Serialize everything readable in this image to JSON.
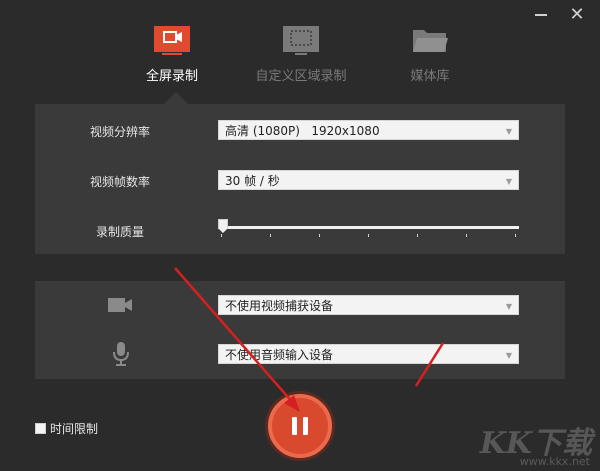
{
  "window": {
    "minimize_label": "—",
    "close_label": "✕"
  },
  "tabs": [
    {
      "id": "fullscreen",
      "label": "全屏录制",
      "active": true,
      "icon": "screen-record-icon"
    },
    {
      "id": "region",
      "label": "自定义区域录制",
      "active": false,
      "icon": "region-select-icon"
    },
    {
      "id": "library",
      "label": "媒体库",
      "active": false,
      "icon": "folder-icon"
    }
  ],
  "video_settings": {
    "resolution": {
      "label": "视频分辨率",
      "value": "高清 (1080P)   1920x1080"
    },
    "framerate": {
      "label": "视频帧数率",
      "value": "30 帧 / 秒"
    },
    "quality": {
      "label": "录制质量",
      "level": 0
    }
  },
  "devices": {
    "camera": {
      "icon": "camera-icon",
      "value": "不使用视频捕获设备"
    },
    "microphone": {
      "icon": "microphone-icon",
      "value": "不使用音频输入设备"
    }
  },
  "time_limit": {
    "label": "时间限制",
    "checked": false
  },
  "record_button": {
    "state": "pause",
    "icon": "pause-icon"
  },
  "colors": {
    "accent": "#e04a2f",
    "background": "#2b2b2b",
    "panel": "#3a3a3a",
    "annotation_arrow": "#d42020"
  },
  "watermark": {
    "text": "KK下载",
    "url": "www.kkx.net"
  }
}
